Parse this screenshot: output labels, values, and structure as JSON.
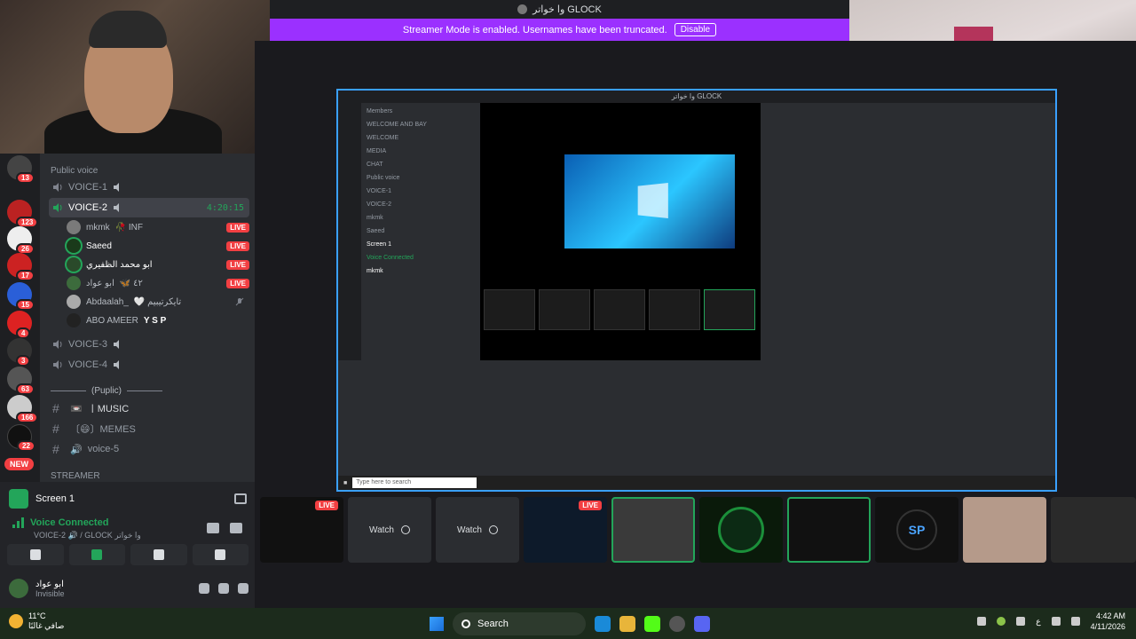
{
  "window_title": "وا خواتر GLOCK",
  "streamer_banner": {
    "text": "Streamer Mode is enabled. Usernames have been truncated.",
    "button": "Disable"
  },
  "rail": {
    "badges": [
      "13",
      "123",
      "26",
      "17",
      "15",
      "4",
      "3",
      "63",
      "166",
      "22"
    ],
    "new_label": "NEW"
  },
  "channels": {
    "category_public_voice": "Public voice",
    "voice1": "VOICE-1",
    "voice2": "VOICE-2",
    "voice2_timer": "4:20:15",
    "members": [
      {
        "name": "mkmk",
        "tag": "🥀 INF",
        "live": "LIVE"
      },
      {
        "name": "Saeed",
        "tag": "",
        "live": "LIVE"
      },
      {
        "name": "ابو محمد الظفيري",
        "tag": "",
        "live": "LIVE"
      },
      {
        "name": "ابو عواد",
        "tag": "🦋 ٤٢",
        "live": "LIVE"
      },
      {
        "name": "Abdaalah_",
        "tag": "🤍 تايكرتيبيم",
        "live": ""
      },
      {
        "name": "ABO AMEER",
        "tag": "Y S P",
        "live": ""
      }
    ],
    "voice3": "VOICE-3",
    "voice4": "VOICE-4",
    "divider": "(Puplic)",
    "text_channels": [
      {
        "name": "〡MUSIC",
        "prefix": "📼"
      },
      {
        "name": "〔😄〕MEMES",
        "prefix": ""
      },
      {
        "name": "voice-5",
        "prefix": "🔊"
      }
    ],
    "category_streamer": "STREAMER"
  },
  "panel": {
    "screen_title": "Screen 1",
    "voice_connected": "Voice Connected",
    "voice_sub": "VOICE-2 🔊 / GLOCK وا خواتر",
    "username": "ابو عواد",
    "status": "Invisible"
  },
  "inner": {
    "title": "وا خواتر GLOCK",
    "channels": [
      "Members",
      "WELCOME AND BAY",
      "WELCOME",
      "MEDIA",
      "CHAT",
      "Public voice",
      "VOICE-1",
      "VOICE-2",
      "mkmk",
      "Saeed",
      "Screen 1",
      "Voice Connected",
      "mkmk"
    ],
    "search_placeholder": "Type here to search"
  },
  "thumbnails": [
    {
      "type": "live",
      "label": "LIVE"
    },
    {
      "type": "watch",
      "label": "Watch"
    },
    {
      "type": "watch",
      "label": "Watch"
    },
    {
      "type": "live",
      "label": "LIVE"
    },
    {
      "type": "photo",
      "label": ""
    },
    {
      "type": "logo",
      "label": ""
    },
    {
      "type": "dark",
      "label": ""
    },
    {
      "type": "sp",
      "label": "SP"
    },
    {
      "type": "avatar",
      "label": ""
    },
    {
      "type": "avatar",
      "label": ""
    }
  ],
  "taskbar": {
    "temp": "11°C",
    "weather_desc": "صافي غالبًا",
    "search": "Search",
    "lang": "ع",
    "time": "4:42 AM",
    "date": "4/11/2026"
  },
  "colors": {
    "streamer_purple": "#9b30ff",
    "live_red": "#f23f42",
    "voice_green": "#23a55a",
    "share_border": "#3aa0ff"
  }
}
